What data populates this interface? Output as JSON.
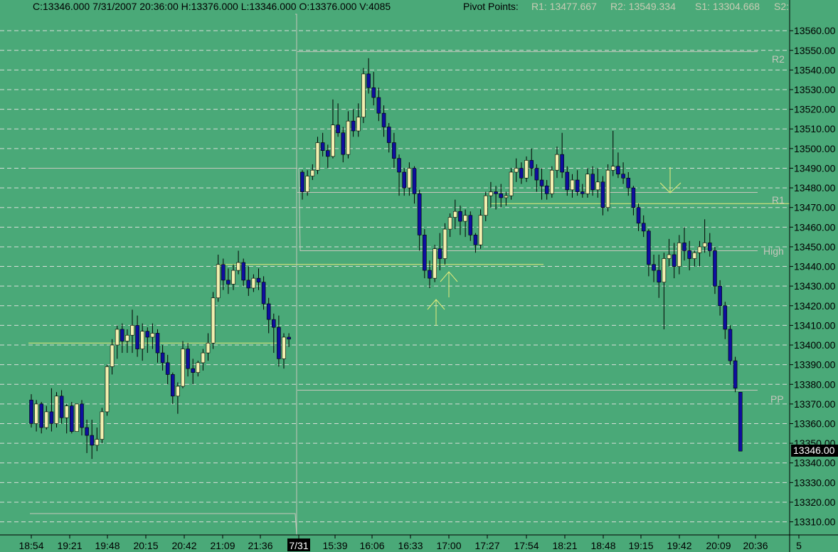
{
  "header": {
    "quote": "C:13346.000  7/31/2007  20:36:00  H:13376.000  L:13346.000  O:13376.000  V:4085",
    "pivot_title": "Pivot Points:",
    "r1": "R1: 13477.667",
    "r2": "R2: 13549.334",
    "s1": "S1: 13304.668",
    "s2": "S2:"
  },
  "colors": {
    "background": "#4aa978",
    "grid": "#d7ded8",
    "up_body": "#f2f0b0",
    "down_body": "#0e0e9e",
    "wick": "#000000",
    "pivot_line": "#c7c7bd",
    "trend_line": "#e6ec7c",
    "arrow": "#e6ec7c",
    "price_label_bg": "#000000",
    "price_label_fg": "#ffffff"
  },
  "chart_data": {
    "type": "candlestick",
    "ylim": [
      13300,
      13565
    ],
    "yticks": [
      "13310.00",
      "13320.00",
      "13330.00",
      "13340.00",
      "13350.00",
      "13360.00",
      "13370.00",
      "13380.00",
      "13390.00",
      "13400.00",
      "13410.00",
      "13420.00",
      "13430.00",
      "13440.00",
      "13450.00",
      "13460.00",
      "13470.00",
      "13480.00",
      "13490.00",
      "13500.00",
      "13510.00",
      "13520.00",
      "13530.00",
      "13540.00",
      "13550.00",
      "13560.00"
    ],
    "xticks": [
      "18:54",
      "19:21",
      "19:48",
      "20:15",
      "20:42",
      "21:09",
      "21:36",
      "7/31",
      "15:39",
      "16:06",
      "16:33",
      "17:00",
      "17:27",
      "17:54",
      "18:21",
      "18:48",
      "19:15",
      "19:42",
      "20:09",
      "20:36",
      "5"
    ],
    "last_price_label": "13346.00",
    "pivot_labels": {
      "r2": "R2",
      "r1": "R1",
      "high": "High",
      "pp": "PP"
    },
    "pivot_levels": {
      "r2": 13549.334,
      "r1": 13477.667,
      "high": 13448,
      "pp": 13377
    },
    "session_break": "7/31",
    "candles_previous": [
      [
        13372,
        13375,
        13358,
        13360
      ],
      [
        13360,
        13372,
        13356,
        13370
      ],
      [
        13370,
        13371,
        13355,
        13358
      ],
      [
        13358,
        13369,
        13357,
        13366
      ],
      [
        13366,
        13378,
        13356,
        13360
      ],
      [
        13360,
        13376,
        13358,
        13374
      ],
      [
        13374,
        13377,
        13360,
        13363
      ],
      [
        13363,
        13370,
        13355,
        13369
      ],
      [
        13369,
        13371,
        13355,
        13356
      ],
      [
        13356,
        13370,
        13356,
        13370
      ],
      [
        13370,
        13372,
        13354,
        13358
      ],
      [
        13358,
        13362,
        13345,
        13354
      ],
      [
        13354,
        13362,
        13342,
        13349
      ],
      [
        13349,
        13358,
        13346,
        13352
      ],
      [
        13352,
        13368,
        13350,
        13366
      ],
      [
        13366,
        13390,
        13364,
        13389
      ],
      [
        13389,
        13403,
        13385,
        13400
      ],
      [
        13400,
        13410,
        13393,
        13408
      ],
      [
        13408,
        13411,
        13396,
        13402
      ],
      [
        13402,
        13408,
        13396,
        13405
      ],
      [
        13405,
        13418,
        13396,
        13410
      ],
      [
        13410,
        13415,
        13394,
        13398
      ],
      [
        13398,
        13411,
        13392,
        13407
      ],
      [
        13407,
        13409,
        13396,
        13404
      ],
      [
        13404,
        13411,
        13398,
        13406
      ],
      [
        13406,
        13408,
        13391,
        13396
      ],
      [
        13396,
        13400,
        13387,
        13391
      ],
      [
        13391,
        13395,
        13380,
        13385
      ],
      [
        13385,
        13386,
        13370,
        13374
      ],
      [
        13374,
        13381,
        13365,
        13379
      ],
      [
        13379,
        13402,
        13378,
        13398
      ],
      [
        13398,
        13401,
        13384,
        13388
      ],
      [
        13388,
        13393,
        13380,
        13386
      ],
      [
        13386,
        13392,
        13384,
        13391
      ],
      [
        13391,
        13398,
        13387,
        13396
      ],
      [
        13396,
        13406,
        13392,
        13401
      ],
      [
        13401,
        13427,
        13398,
        13424
      ],
      [
        13424,
        13446,
        13422,
        13441
      ],
      [
        13441,
        13444,
        13428,
        13433
      ],
      [
        13433,
        13439,
        13426,
        13431
      ],
      [
        13431,
        13441,
        13428,
        13438
      ],
      [
        13438,
        13448,
        13436,
        13442
      ],
      [
        13442,
        13444,
        13430,
        13433
      ],
      [
        13433,
        13440,
        13425,
        13429
      ],
      [
        13429,
        13436,
        13427,
        13434
      ],
      [
        13434,
        13439,
        13428,
        13432
      ],
      [
        13432,
        13435,
        13418,
        13421
      ],
      [
        13421,
        13424,
        13406,
        13413
      ],
      [
        13413,
        13416,
        13396,
        13409
      ],
      [
        13409,
        13415,
        13389,
        13393
      ],
      [
        13393,
        13406,
        13388,
        13404
      ],
      [
        13404,
        13406,
        13399,
        13403
      ]
    ],
    "candles_current": [
      [
        13488,
        13489,
        13474,
        13478
      ],
      [
        13478,
        13489,
        13476,
        13486
      ],
      [
        13486,
        13492,
        13484,
        13489
      ],
      [
        13489,
        13506,
        13487,
        13503
      ],
      [
        13503,
        13508,
        13496,
        13499
      ],
      [
        13499,
        13502,
        13490,
        13496
      ],
      [
        13496,
        13525,
        13495,
        13512
      ],
      [
        13512,
        13523,
        13506,
        13508
      ],
      [
        13508,
        13511,
        13493,
        13497
      ],
      [
        13497,
        13519,
        13495,
        13514
      ],
      [
        13514,
        13520,
        13506,
        13509
      ],
      [
        13509,
        13523,
        13506,
        13516
      ],
      [
        13516,
        13541,
        13513,
        13538
      ],
      [
        13538,
        13546,
        13528,
        13531
      ],
      [
        13531,
        13539,
        13522,
        13526
      ],
      [
        13526,
        13531,
        13514,
        13518
      ],
      [
        13518,
        13522,
        13506,
        13511
      ],
      [
        13511,
        13513,
        13498,
        13503
      ],
      [
        13503,
        13508,
        13490,
        13495
      ],
      [
        13495,
        13497,
        13476,
        13488
      ],
      [
        13488,
        13490,
        13476,
        13480
      ],
      [
        13480,
        13493,
        13476,
        13490
      ],
      [
        13490,
        13491,
        13472,
        13477
      ],
      [
        13477,
        13479,
        13448,
        13456
      ],
      [
        13456,
        13459,
        13434,
        13438
      ],
      [
        13438,
        13443,
        13429,
        13434
      ],
      [
        13434,
        13451,
        13432,
        13449
      ],
      [
        13449,
        13457,
        13438,
        13444
      ],
      [
        13444,
        13462,
        13441,
        13459
      ],
      [
        13459,
        13467,
        13455,
        13465
      ],
      [
        13465,
        13474,
        13459,
        13468
      ],
      [
        13468,
        13471,
        13456,
        13463
      ],
      [
        13463,
        13469,
        13455,
        13466
      ],
      [
        13466,
        13468,
        13453,
        13456
      ],
      [
        13456,
        13457,
        13447,
        13451
      ],
      [
        13451,
        13469,
        13449,
        13466
      ],
      [
        13466,
        13478,
        13463,
        13476
      ],
      [
        13476,
        13483,
        13470,
        13478
      ],
      [
        13478,
        13481,
        13469,
        13477
      ],
      [
        13477,
        13482,
        13470,
        13475
      ],
      [
        13475,
        13478,
        13471,
        13476
      ],
      [
        13476,
        13490,
        13474,
        13488
      ],
      [
        13488,
        13495,
        13483,
        13490
      ],
      [
        13490,
        13493,
        13482,
        13485
      ],
      [
        13485,
        13496,
        13483,
        13494
      ],
      [
        13494,
        13500,
        13486,
        13490
      ],
      [
        13490,
        13492,
        13478,
        13484
      ],
      [
        13484,
        13490,
        13474,
        13481
      ],
      [
        13481,
        13484,
        13474,
        13477
      ],
      [
        13477,
        13491,
        13475,
        13489
      ],
      [
        13489,
        13501,
        13485,
        13497
      ],
      [
        13497,
        13508,
        13485,
        13488
      ],
      [
        13488,
        13491,
        13476,
        13479
      ],
      [
        13479,
        13487,
        13475,
        13484
      ],
      [
        13484,
        13489,
        13476,
        13478
      ],
      [
        13478,
        13482,
        13475,
        13477
      ],
      [
        13477,
        13490,
        13475,
        13487
      ],
      [
        13487,
        13491,
        13476,
        13479
      ],
      [
        13479,
        13490,
        13475,
        13483
      ],
      [
        13483,
        13486,
        13466,
        13470
      ],
      [
        13470,
        13492,
        13468,
        13489
      ],
      [
        13489,
        13509,
        13486,
        13491
      ],
      [
        13491,
        13498,
        13485,
        13487
      ],
      [
        13487,
        13493,
        13482,
        13485
      ],
      [
        13485,
        13488,
        13476,
        13480
      ],
      [
        13480,
        13481,
        13466,
        13470
      ],
      [
        13470,
        13472,
        13458,
        13462
      ],
      [
        13462,
        13466,
        13455,
        13458
      ],
      [
        13458,
        13459,
        13435,
        13441
      ],
      [
        13441,
        13446,
        13432,
        13438
      ],
      [
        13438,
        13446,
        13424,
        13432
      ],
      [
        13432,
        13447,
        13408,
        13444
      ],
      [
        13444,
        13454,
        13440,
        13446
      ],
      [
        13446,
        13452,
        13434,
        13440
      ],
      [
        13440,
        13456,
        13436,
        13452
      ],
      [
        13452,
        13460,
        13443,
        13448
      ],
      [
        13448,
        13453,
        13438,
        13444
      ],
      [
        13444,
        13448,
        13440,
        13447
      ],
      [
        13447,
        13453,
        13440,
        13450
      ],
      [
        13450,
        13464,
        13447,
        13452
      ],
      [
        13452,
        13457,
        13445,
        13448
      ],
      [
        13448,
        13450,
        13426,
        13430
      ],
      [
        13430,
        13433,
        13415,
        13420
      ],
      [
        13420,
        13422,
        13403,
        13408
      ],
      [
        13408,
        13410,
        13390,
        13392
      ],
      [
        13392,
        13394,
        13376,
        13378
      ],
      [
        13376,
        13376,
        13346,
        13346
      ]
    ],
    "trend_lines": [
      {
        "label": "prev-high-line",
        "y": 13441
      },
      {
        "label": "r1-line",
        "y": 13472
      }
    ]
  }
}
